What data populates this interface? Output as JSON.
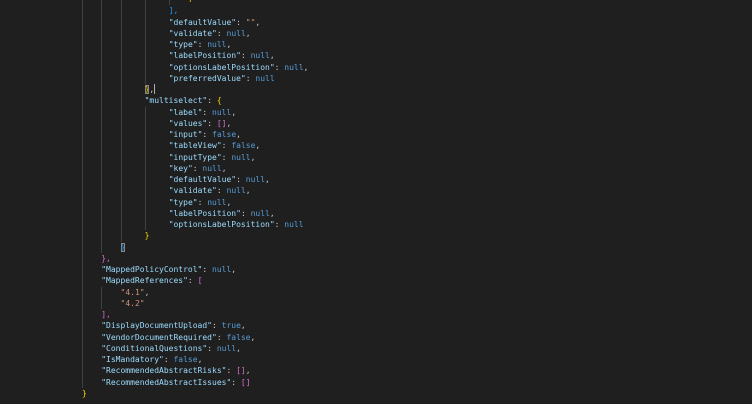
{
  "lines": [
    {
      "indent": 39,
      "parts": [
        {
          "t": "f",
          "c": "b1"
        }
      ]
    },
    {
      "indent": 35,
      "parts": [
        {
          "t": "],",
          "c": "b3"
        }
      ]
    },
    {
      "indent": 35,
      "parts": [
        {
          "t": "\"defaultValue\"",
          "c": "key"
        },
        {
          "t": ": ",
          "c": "p"
        },
        {
          "t": "\"\"",
          "c": "str"
        },
        {
          "t": ",",
          "c": "p"
        }
      ]
    },
    {
      "indent": 35,
      "parts": [
        {
          "t": "\"validate\"",
          "c": "key"
        },
        {
          "t": ": ",
          "c": "p"
        },
        {
          "t": "null",
          "c": "kw"
        },
        {
          "t": ",",
          "c": "p"
        }
      ]
    },
    {
      "indent": 35,
      "parts": [
        {
          "t": "\"type\"",
          "c": "key"
        },
        {
          "t": ": ",
          "c": "p"
        },
        {
          "t": "null",
          "c": "kw"
        },
        {
          "t": ",",
          "c": "p"
        }
      ]
    },
    {
      "indent": 35,
      "parts": [
        {
          "t": "\"labelPosition\"",
          "c": "key"
        },
        {
          "t": ": ",
          "c": "p"
        },
        {
          "t": "null",
          "c": "kw"
        },
        {
          "t": ",",
          "c": "p"
        }
      ]
    },
    {
      "indent": 35,
      "parts": [
        {
          "t": "\"optionsLabelPosition\"",
          "c": "key"
        },
        {
          "t": ": ",
          "c": "p"
        },
        {
          "t": "null",
          "c": "kw"
        },
        {
          "t": ",",
          "c": "p"
        }
      ]
    },
    {
      "indent": 35,
      "parts": [
        {
          "t": "\"preferredValue\"",
          "c": "key"
        },
        {
          "t": ": ",
          "c": "p"
        },
        {
          "t": "null",
          "c": "kw"
        }
      ]
    },
    {
      "indent": 30,
      "parts": [
        {
          "t": "}",
          "c": "b1 bm"
        },
        {
          "t": ",",
          "c": "p"
        },
        {
          "t": "",
          "c": "cursor"
        }
      ]
    },
    {
      "indent": 30,
      "parts": [
        {
          "t": "\"multiselect\"",
          "c": "key"
        },
        {
          "t": ": ",
          "c": "p"
        },
        {
          "t": "{",
          "c": "b1"
        }
      ]
    },
    {
      "indent": 35,
      "parts": [
        {
          "t": "\"label\"",
          "c": "key"
        },
        {
          "t": ": ",
          "c": "p"
        },
        {
          "t": "null",
          "c": "kw"
        },
        {
          "t": ",",
          "c": "p"
        }
      ]
    },
    {
      "indent": 35,
      "parts": [
        {
          "t": "\"values\"",
          "c": "key"
        },
        {
          "t": ": ",
          "c": "p"
        },
        {
          "t": "[]",
          "c": "b2"
        },
        {
          "t": ",",
          "c": "p"
        }
      ]
    },
    {
      "indent": 35,
      "parts": [
        {
          "t": "\"input\"",
          "c": "key"
        },
        {
          "t": ": ",
          "c": "p"
        },
        {
          "t": "false",
          "c": "kw"
        },
        {
          "t": ",",
          "c": "p"
        }
      ]
    },
    {
      "indent": 35,
      "parts": [
        {
          "t": "\"tableView\"",
          "c": "key"
        },
        {
          "t": ": ",
          "c": "p"
        },
        {
          "t": "false",
          "c": "kw"
        },
        {
          "t": ",",
          "c": "p"
        }
      ]
    },
    {
      "indent": 35,
      "parts": [
        {
          "t": "\"inputType\"",
          "c": "key"
        },
        {
          "t": ": ",
          "c": "p"
        },
        {
          "t": "null",
          "c": "kw"
        },
        {
          "t": ",",
          "c": "p"
        }
      ]
    },
    {
      "indent": 35,
      "parts": [
        {
          "t": "\"key\"",
          "c": "key"
        },
        {
          "t": ": ",
          "c": "p"
        },
        {
          "t": "null",
          "c": "kw"
        },
        {
          "t": ",",
          "c": "p"
        }
      ]
    },
    {
      "indent": 35,
      "parts": [
        {
          "t": "\"defaultValue\"",
          "c": "key"
        },
        {
          "t": ": ",
          "c": "p"
        },
        {
          "t": "null",
          "c": "kw"
        },
        {
          "t": ",",
          "c": "p"
        }
      ]
    },
    {
      "indent": 35,
      "parts": [
        {
          "t": "\"validate\"",
          "c": "key"
        },
        {
          "t": ": ",
          "c": "p"
        },
        {
          "t": "null",
          "c": "kw"
        },
        {
          "t": ",",
          "c": "p"
        }
      ]
    },
    {
      "indent": 35,
      "parts": [
        {
          "t": "\"type\"",
          "c": "key"
        },
        {
          "t": ": ",
          "c": "p"
        },
        {
          "t": "null",
          "c": "kw"
        },
        {
          "t": ",",
          "c": "p"
        }
      ]
    },
    {
      "indent": 35,
      "parts": [
        {
          "t": "\"labelPosition\"",
          "c": "key"
        },
        {
          "t": ": ",
          "c": "p"
        },
        {
          "t": "null",
          "c": "kw"
        },
        {
          "t": ",",
          "c": "p"
        }
      ]
    },
    {
      "indent": 35,
      "parts": [
        {
          "t": "\"optionsLabelPosition\"",
          "c": "key"
        },
        {
          "t": ": ",
          "c": "p"
        },
        {
          "t": "null",
          "c": "kw"
        }
      ]
    },
    {
      "indent": 30,
      "parts": [
        {
          "t": "}",
          "c": "b1"
        }
      ]
    },
    {
      "indent": 25,
      "parts": [
        {
          "t": "}",
          "c": "b3 bm"
        }
      ]
    },
    {
      "indent": 21,
      "parts": [
        {
          "t": "},",
          "c": "b2"
        }
      ]
    },
    {
      "indent": 21,
      "parts": [
        {
          "t": "\"MappedPolicyControl\"",
          "c": "key"
        },
        {
          "t": ": ",
          "c": "p"
        },
        {
          "t": "null",
          "c": "kw"
        },
        {
          "t": ",",
          "c": "p"
        }
      ]
    },
    {
      "indent": 21,
      "parts": [
        {
          "t": "\"MappedReferences\"",
          "c": "key"
        },
        {
          "t": ": ",
          "c": "p"
        },
        {
          "t": "[",
          "c": "b2"
        }
      ]
    },
    {
      "indent": 25,
      "parts": [
        {
          "t": "\"4.1\"",
          "c": "str"
        },
        {
          "t": ",",
          "c": "p"
        }
      ]
    },
    {
      "indent": 25,
      "parts": [
        {
          "t": "\"4.2\"",
          "c": "str"
        }
      ]
    },
    {
      "indent": 21,
      "parts": [
        {
          "t": "],",
          "c": "b2"
        }
      ]
    },
    {
      "indent": 21,
      "parts": [
        {
          "t": "\"DisplayDocumentUpload\"",
          "c": "key"
        },
        {
          "t": ": ",
          "c": "p"
        },
        {
          "t": "true",
          "c": "kw"
        },
        {
          "t": ",",
          "c": "p"
        }
      ]
    },
    {
      "indent": 21,
      "parts": [
        {
          "t": "\"VendorDocumentRequired\"",
          "c": "key"
        },
        {
          "t": ": ",
          "c": "p"
        },
        {
          "t": "false",
          "c": "kw"
        },
        {
          "t": ",",
          "c": "p"
        }
      ]
    },
    {
      "indent": 21,
      "parts": [
        {
          "t": "\"ConditionalQuestions\"",
          "c": "key"
        },
        {
          "t": ": ",
          "c": "p"
        },
        {
          "t": "null",
          "c": "kw"
        },
        {
          "t": ",",
          "c": "p"
        }
      ]
    },
    {
      "indent": 21,
      "parts": [
        {
          "t": "\"IsMandatory\"",
          "c": "key"
        },
        {
          "t": ": ",
          "c": "p"
        },
        {
          "t": "false",
          "c": "kw"
        },
        {
          "t": ",",
          "c": "p"
        }
      ]
    },
    {
      "indent": 21,
      "parts": [
        {
          "t": "\"RecommendedAbstractRisks\"",
          "c": "key"
        },
        {
          "t": ": ",
          "c": "p"
        },
        {
          "t": "[]",
          "c": "b2"
        },
        {
          "t": ",",
          "c": "p"
        }
      ]
    },
    {
      "indent": 21,
      "parts": [
        {
          "t": "\"RecommendedAbstractIssues\"",
          "c": "key"
        },
        {
          "t": ": ",
          "c": "p"
        },
        {
          "t": "[]",
          "c": "b2"
        }
      ]
    },
    {
      "indent": 17,
      "parts": [
        {
          "t": "}",
          "c": "b1"
        }
      ]
    }
  ]
}
